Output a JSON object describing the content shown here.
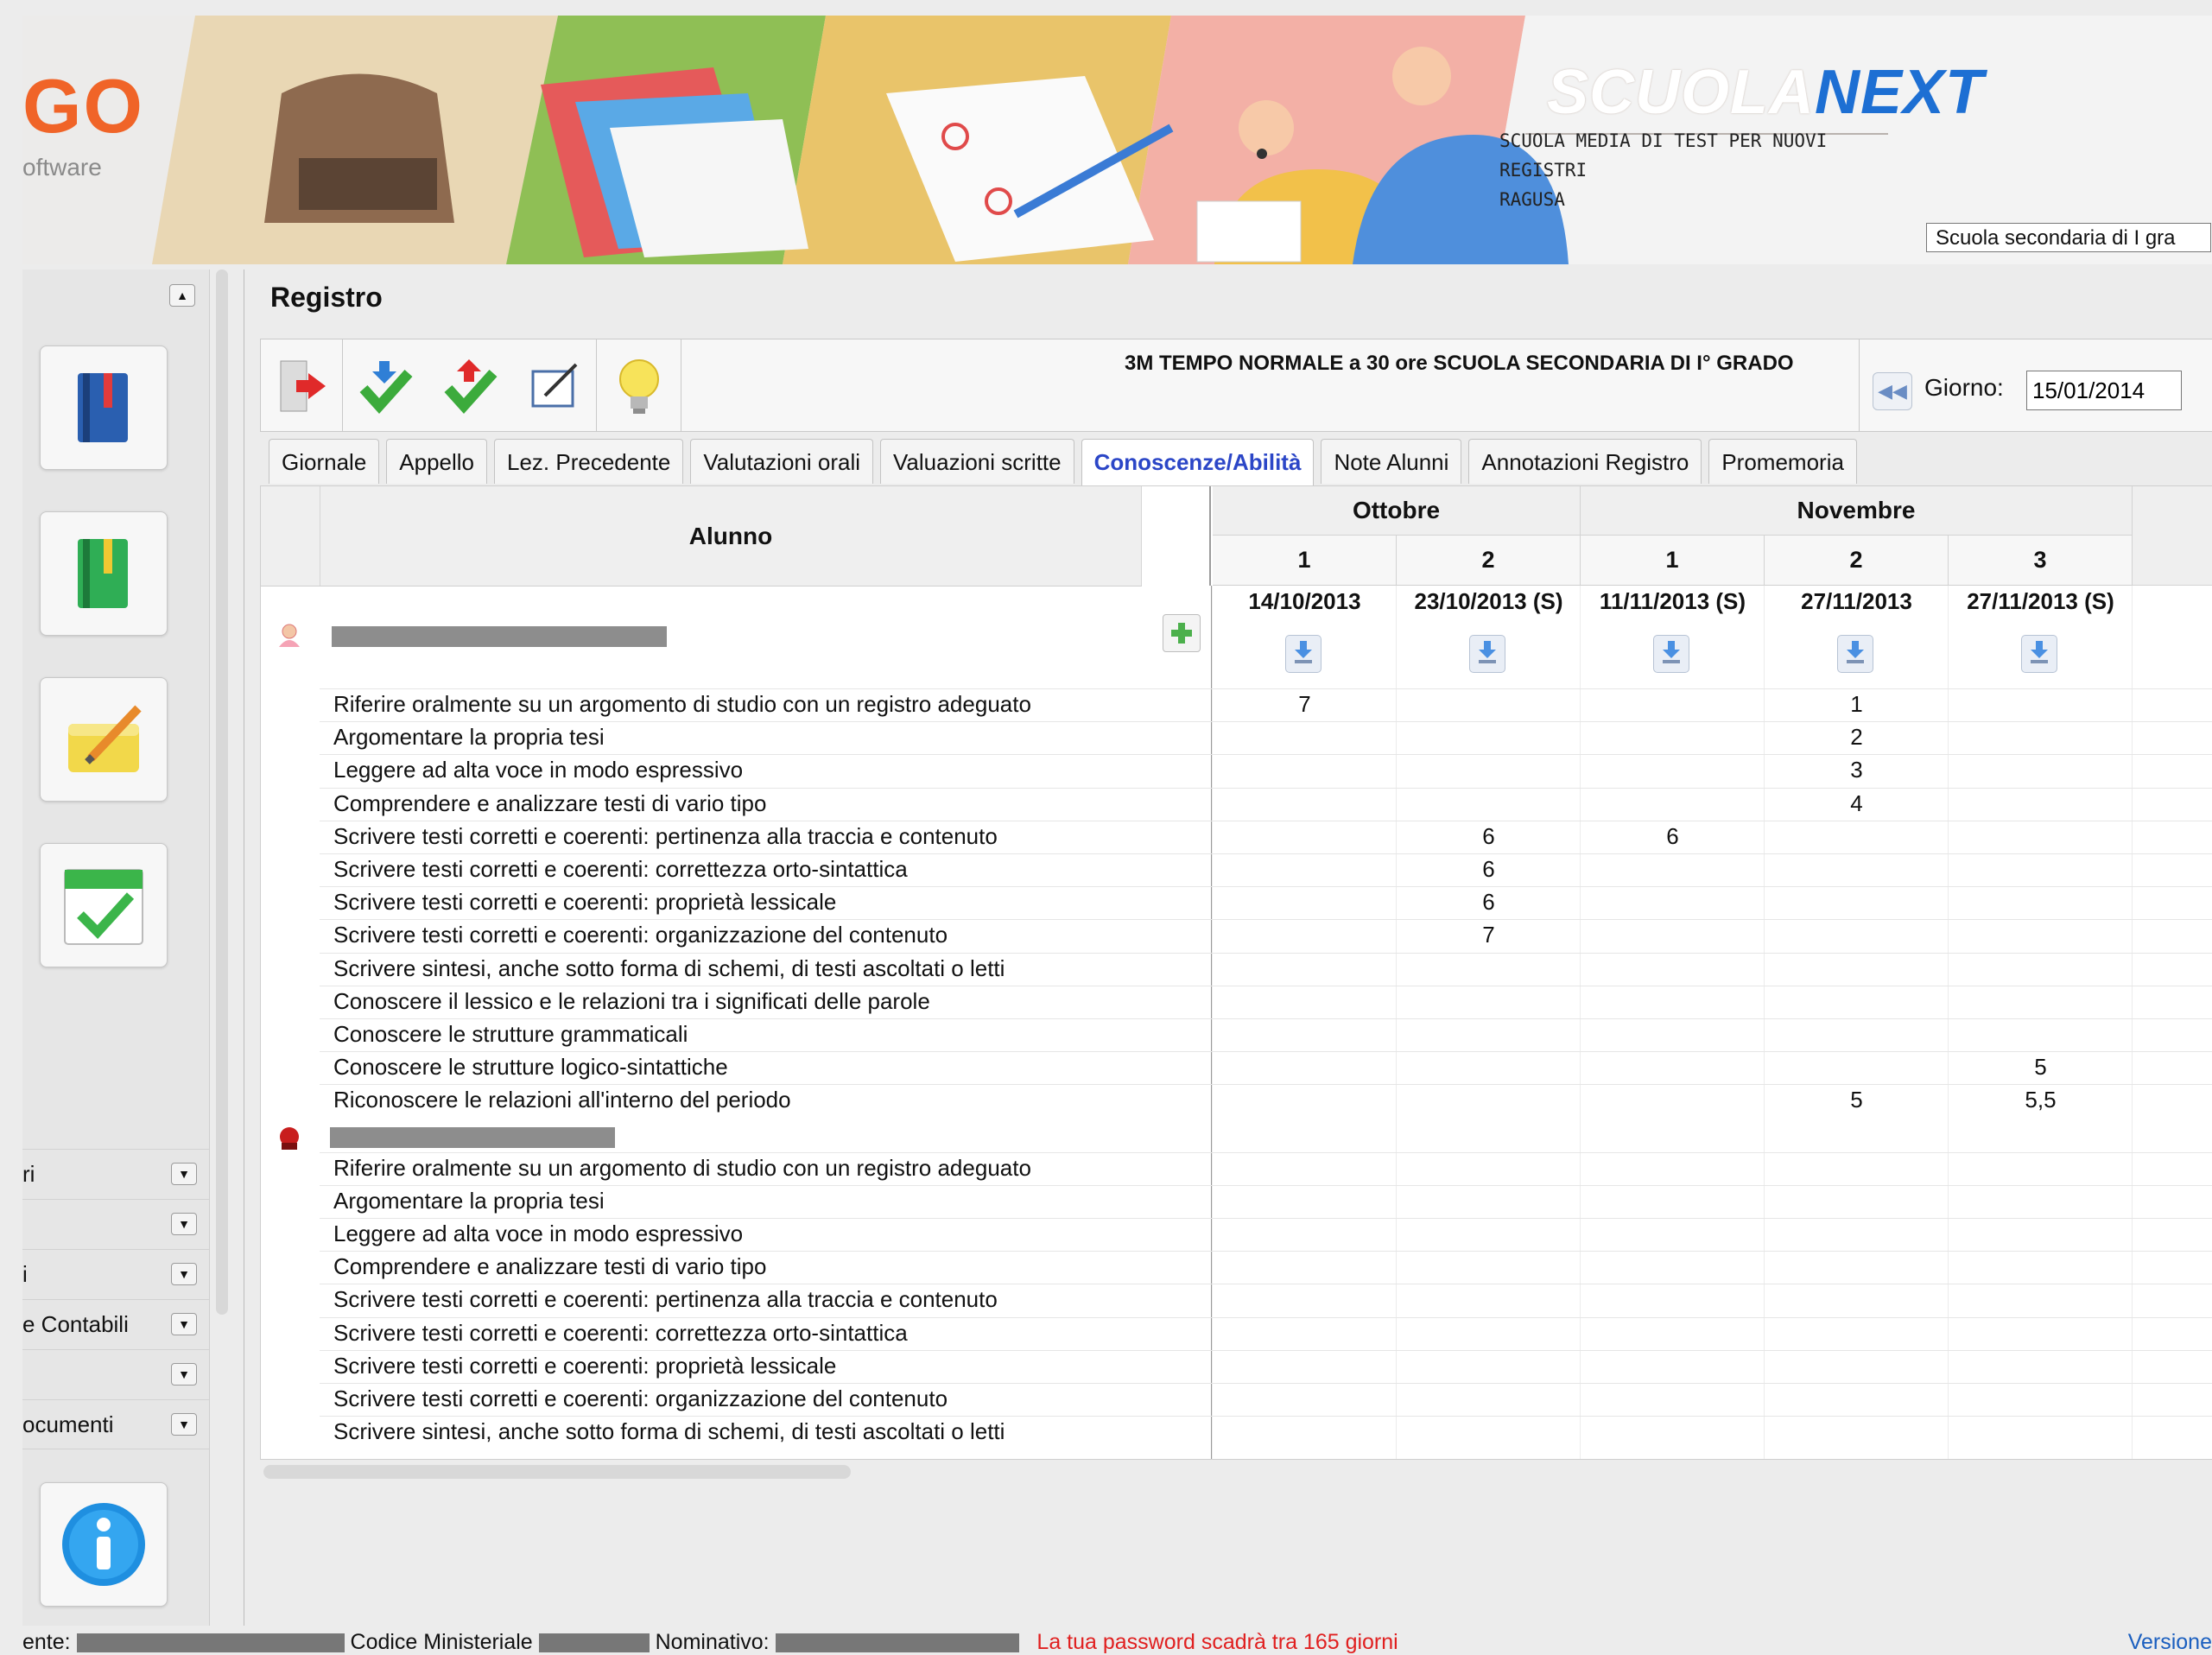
{
  "header": {
    "logo_letters": "GO",
    "logo_sub": "oftware",
    "brand_part1": "SCUOLA",
    "brand_part2": "NEXT",
    "school_line1": "SCUOLA MEDIA DI TEST PER NUOVI",
    "school_line2": "REGISTRI",
    "school_city": "RAGUSA",
    "school_select_value": "Scuola secondaria di I gra"
  },
  "sidebar": {
    "tiles": [
      "registro-book-blue",
      "registro-book-green",
      "notes-pencil",
      "calendar-check"
    ],
    "menu": [
      {
        "label": "ri"
      },
      {
        "label": ""
      },
      {
        "label": "i"
      },
      {
        "label": "e Contabili"
      },
      {
        "label": ""
      },
      {
        "label": "ocumenti"
      }
    ],
    "info_tile": "info-icon"
  },
  "main": {
    "title": "Registro",
    "class_title": "3M TEMPO NORMALE a 30 ore SCUOLA SECONDARIA DI I° GRADO",
    "giorno_label": "Giorno:",
    "giorno_value": "15/01/2014",
    "toolbar_icons": [
      "exit-icon",
      "download-check-icon",
      "upload-check-icon",
      "edit-icon",
      "lightbulb-icon"
    ]
  },
  "tabs": [
    {
      "label": "Giornale"
    },
    {
      "label": "Appello"
    },
    {
      "label": "Lez. Precedente"
    },
    {
      "label": "Valutazioni orali"
    },
    {
      "label": "Valuazioni scritte"
    },
    {
      "label": "Conoscenze/Abilità",
      "active": true
    },
    {
      "label": "Note Alunni"
    },
    {
      "label": "Annotazioni Registro"
    },
    {
      "label": "Promemoria"
    }
  ],
  "grid": {
    "alunno_header": "Alunno",
    "months": [
      {
        "name": "Ottobre",
        "weeks": [
          "1",
          "2"
        ]
      },
      {
        "name": "Novembre",
        "weeks": [
          "1",
          "2",
          "3"
        ]
      }
    ],
    "dates": [
      "14/10/2013",
      "23/10/2013 (S)",
      "11/11/2013 (S)",
      "27/11/2013",
      "27/11/2013 (S)"
    ],
    "students": [
      {
        "icon": "female-student-icon",
        "skills": [
          {
            "label": "Riferire oralmente su un argomento di studio con un registro adeguato",
            "grades": [
              "7",
              "",
              "",
              "1",
              ""
            ]
          },
          {
            "label": "Argomentare la propria tesi",
            "grades": [
              "",
              "",
              "",
              "2",
              ""
            ]
          },
          {
            "label": "Leggere ad alta voce in modo espressivo",
            "grades": [
              "",
              "",
              "",
              "3",
              ""
            ]
          },
          {
            "label": "Comprendere e analizzare testi di vario tipo",
            "grades": [
              "",
              "",
              "",
              "4",
              ""
            ]
          },
          {
            "label": "Scrivere testi corretti e coerenti: pertinenza alla traccia e contenuto",
            "grades": [
              "",
              "6",
              "6",
              "",
              ""
            ]
          },
          {
            "label": "Scrivere testi corretti e coerenti: correttezza orto-sintattica",
            "grades": [
              "",
              "6",
              "",
              "",
              ""
            ]
          },
          {
            "label": "Scrivere testi corretti e coerenti: proprietà lessicale",
            "grades": [
              "",
              "6",
              "",
              "",
              ""
            ]
          },
          {
            "label": "Scrivere testi corretti e coerenti: organizzazione del contenuto",
            "grades": [
              "",
              "7",
              "",
              "",
              ""
            ]
          },
          {
            "label": "Scrivere sintesi, anche sotto forma di schemi, di testi ascoltati o letti",
            "grades": [
              "",
              "",
              "",
              "",
              ""
            ]
          },
          {
            "label": "Conoscere il lessico e le relazioni tra i significati delle parole",
            "grades": [
              "",
              "",
              "",
              "",
              ""
            ]
          },
          {
            "label": "Conoscere le strutture grammaticali",
            "grades": [
              "",
              "",
              "",
              "",
              ""
            ]
          },
          {
            "label": "Conoscere le strutture logico-sintattiche",
            "grades": [
              "",
              "",
              "",
              "",
              "5"
            ]
          },
          {
            "label": "Riconoscere le relazioni all'interno del periodo",
            "grades": [
              "",
              "",
              "",
              "5",
              "5,5"
            ]
          }
        ]
      },
      {
        "icon": "male-student-icon",
        "skills": [
          {
            "label": "Riferire oralmente su un argomento di studio con un registro adeguato",
            "grades": [
              "",
              "",
              "",
              "",
              ""
            ]
          },
          {
            "label": "Argomentare la propria tesi",
            "grades": [
              "",
              "",
              "",
              "",
              ""
            ]
          },
          {
            "label": "Leggere ad alta voce in modo espressivo",
            "grades": [
              "",
              "",
              "",
              "",
              ""
            ]
          },
          {
            "label": "Comprendere e analizzare testi di vario tipo",
            "grades": [
              "",
              "",
              "",
              "",
              ""
            ]
          },
          {
            "label": "Scrivere testi corretti e coerenti: pertinenza alla traccia e contenuto",
            "grades": [
              "",
              "",
              "",
              "",
              ""
            ]
          },
          {
            "label": "Scrivere testi corretti e coerenti: correttezza orto-sintattica",
            "grades": [
              "",
              "",
              "",
              "",
              ""
            ]
          },
          {
            "label": "Scrivere testi corretti e coerenti: proprietà lessicale",
            "grades": [
              "",
              "",
              "",
              "",
              ""
            ]
          },
          {
            "label": "Scrivere testi corretti e coerenti: organizzazione del contenuto",
            "grades": [
              "",
              "",
              "",
              "",
              ""
            ]
          },
          {
            "label": "Scrivere sintesi, anche sotto forma di schemi, di testi ascoltati o letti",
            "grades": [
              "",
              "",
              "",
              "",
              ""
            ]
          }
        ]
      }
    ]
  },
  "status": {
    "utente_label": "ente:",
    "codice_label": "Codice Ministeriale",
    "nominativo_label": "Nominativo:",
    "password_warning": "La tua password scadrà tra 165 giorni",
    "version_label": "Versione"
  },
  "colors": {
    "accent_tab": "#2b46c7",
    "warning": "#e02020",
    "brand_next": "#1d6fd3"
  }
}
